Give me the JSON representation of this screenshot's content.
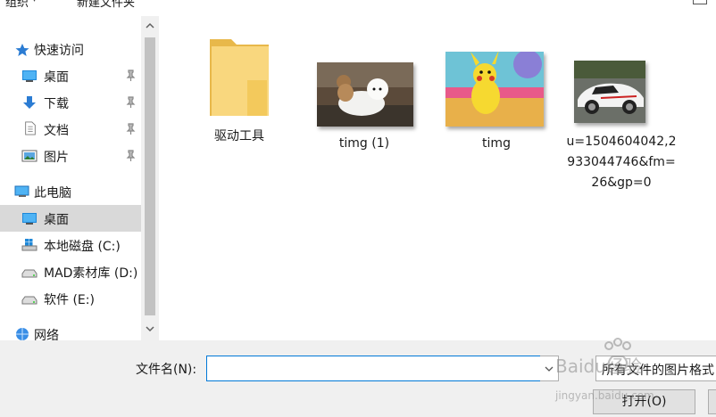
{
  "toolbar": {
    "organize": "组织",
    "new_folder": "新建文件夹"
  },
  "nav": {
    "quick_access": "快速访问",
    "pinned": [
      {
        "label": "桌面",
        "icon": "desktop-icon"
      },
      {
        "label": "下载",
        "icon": "download-arrow-icon"
      },
      {
        "label": "文档",
        "icon": "document-icon"
      },
      {
        "label": "图片",
        "icon": "pictures-icon"
      }
    ],
    "this_pc": "此电脑",
    "pc_items": [
      {
        "label": "桌面",
        "icon": "desktop-icon"
      },
      {
        "label": "本地磁盘 (C:)",
        "icon": "windows-drive-icon"
      },
      {
        "label": "MAD素材库 (D:)",
        "icon": "drive-icon"
      },
      {
        "label": "软件 (E:)",
        "icon": "drive-icon"
      }
    ],
    "network": "网络"
  },
  "files": [
    {
      "label": "驱动工具",
      "type": "folder-icon"
    },
    {
      "label": "timg (1)",
      "type": "image-thumbnail"
    },
    {
      "label": "timg",
      "type": "image-thumbnail"
    },
    {
      "label": "u=1504604042,2933044746&fm=26&gp=0",
      "type": "image-thumbnail"
    }
  ],
  "bottom": {
    "filename_label": "文件名(N):",
    "filename_value": "",
    "filetype_value": "所有文件的图片格式",
    "open_button": "打开(O)"
  },
  "watermark": {
    "brand": "Baidu经验",
    "url": "jingyan.baidu.com"
  },
  "colors": {
    "selected_bg": "#d9d9d9",
    "accent": "#0078d7",
    "folder": "#f9d77e",
    "footer_bg": "#f0f0f0"
  }
}
